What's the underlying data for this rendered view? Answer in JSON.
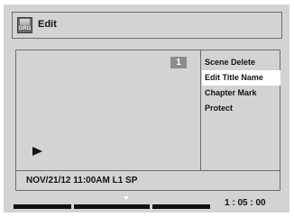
{
  "header": {
    "icon_label": "ORG",
    "title": "Edit"
  },
  "preview": {
    "title_number": "1",
    "state_icon": "play-icon"
  },
  "menu": {
    "items": [
      {
        "label": "Scene Delete",
        "selected": false
      },
      {
        "label": "Edit Title Name",
        "selected": true
      },
      {
        "label": "Chapter Mark",
        "selected": false
      },
      {
        "label": "Protect",
        "selected": false
      }
    ]
  },
  "info": {
    "recording_info": "NOV/21/12 11:00AM L1 SP"
  },
  "timeline": {
    "time": "1 : 05 : 00"
  },
  "colors": {
    "background": "#d3d3d3",
    "border": "#6e6e6e",
    "highlight": "#ffffff",
    "text": "#111111"
  }
}
